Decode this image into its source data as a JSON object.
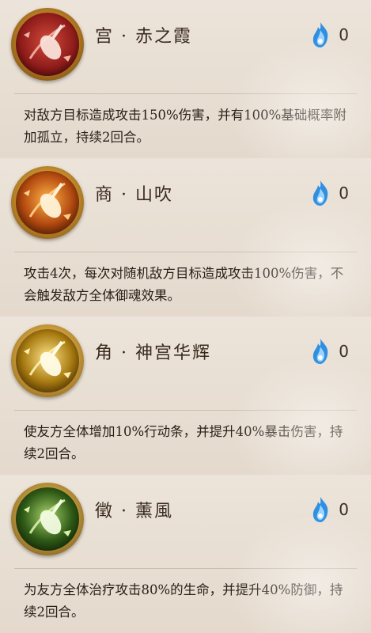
{
  "skills": [
    {
      "name": "宫 · 赤之霞",
      "cost": "0",
      "description": "对敌方目标造成攻击150%伤害，并有100%基础概率附加孤立，持续2回合。",
      "icon": "red-pipa-skill-icon",
      "colors": {
        "inner": "#8f1c1a",
        "glow": "#f2b4a7"
      }
    },
    {
      "name": "商 · 山吹",
      "cost": "0",
      "description": "攻击4次，每次对随机敌方目标造成攻击100%伤害，不会触发敌方全体御魂效果。",
      "icon": "orange-pipa-skill-icon",
      "colors": {
        "inner": "#b34a10",
        "glow": "#ffd08a"
      }
    },
    {
      "name": "角 · 神宫华辉",
      "cost": "0",
      "description": "使友方全体增加10%行动条，并提升40%暴击伤害，持续2回合。",
      "icon": "gold-pipa-skill-icon",
      "colors": {
        "inner": "#a77a10",
        "glow": "#fff0b0"
      }
    },
    {
      "name": "徵 · 薰風",
      "cost": "0",
      "description": "为友方全体治疗攻击80%的生命，并提升40%防御，持续2回合。",
      "icon": "green-pipa-skill-icon",
      "colors": {
        "inner": "#2f5a16",
        "glow": "#d9f2a8"
      }
    }
  ],
  "cost_icon": "blue-soulfire-icon",
  "cost_color": "#2f8fe0"
}
